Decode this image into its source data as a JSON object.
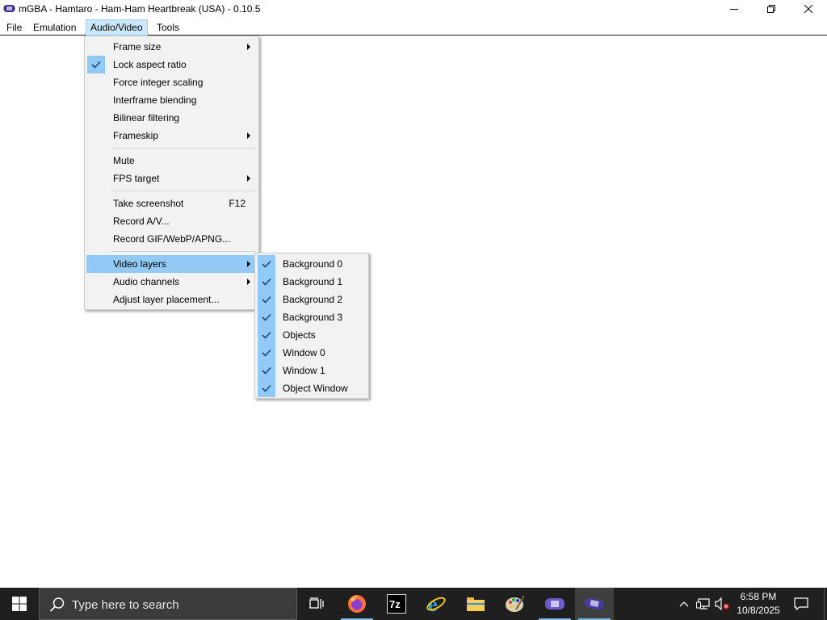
{
  "window": {
    "title": "mGBA - Hamtaro - Ham-Ham Heartbreak (USA) - 0.10.5",
    "controls": [
      "minimize-icon",
      "restore-icon",
      "close-icon"
    ]
  },
  "menubar": {
    "items": [
      "File",
      "Emulation",
      "Audio/Video",
      "Tools"
    ]
  },
  "audio_video_menu": {
    "items": [
      {
        "label": "Frame size",
        "submenu": true
      },
      {
        "label": "Lock aspect ratio",
        "checked": true
      },
      {
        "label": "Force integer scaling"
      },
      {
        "label": "Interframe blending"
      },
      {
        "label": "Bilinear filtering"
      },
      {
        "label": "Frameskip",
        "submenu": true
      },
      {
        "label": "Mute"
      },
      {
        "label": "FPS target",
        "submenu": true
      },
      {
        "label": "Take screenshot",
        "shortcut": "F12"
      },
      {
        "label": "Record A/V..."
      },
      {
        "label": "Record GIF/WebP/APNG..."
      },
      {
        "label": "Video layers",
        "submenu": true,
        "highlighted": true
      },
      {
        "label": "Audio channels",
        "submenu": true
      },
      {
        "label": "Adjust layer placement..."
      }
    ]
  },
  "video_layers_menu": {
    "items": [
      {
        "label": "Background 0",
        "checked": true
      },
      {
        "label": "Background 1",
        "checked": true
      },
      {
        "label": "Background 2",
        "checked": true
      },
      {
        "label": "Background 3",
        "checked": true
      },
      {
        "label": "Objects",
        "checked": true
      },
      {
        "label": "Window 0",
        "checked": true
      },
      {
        "label": "Window 1",
        "checked": true
      },
      {
        "label": "Object Window",
        "checked": true
      }
    ]
  },
  "taskbar": {
    "search_placeholder": "Type here to search",
    "apps": [
      "task-view-icon",
      "firefox-icon",
      "7zip-icon",
      "internet-explorer-icon",
      "file-explorer-icon",
      "paint-icon",
      "gba-icon",
      "mgba-icon"
    ],
    "clock_time": "6:58 PM",
    "clock_date": "10/8/2025"
  },
  "colors": {
    "menu_highlight": "#91c9f7",
    "menubar_active": "#cce8ff",
    "taskbar": "#1f1f1f"
  }
}
